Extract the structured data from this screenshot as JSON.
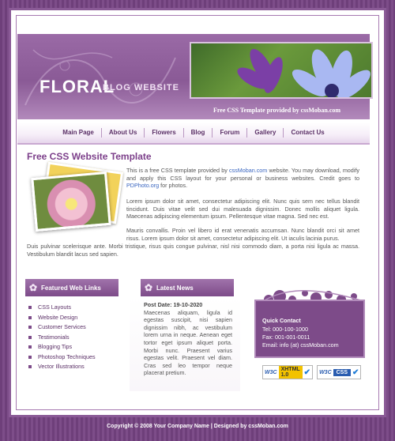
{
  "header": {
    "logo_title": "FLORAL",
    "logo_subtitle": "BLOG WEBSITE",
    "tagline": "Free CSS Template provided by cssMoban.com"
  },
  "nav": {
    "items": [
      "Main Page",
      "About Us",
      "Flowers",
      "Blog",
      "Forum",
      "Gallery",
      "Contact Us"
    ]
  },
  "content": {
    "title": "Free CSS Website Template",
    "intro_part1": "This is a free CSS template provided by ",
    "intro_link1": "cssMoban.com",
    "intro_part2": " website. You may download, modify and apply this CSS layout for your personal or business websites. Credit goes to ",
    "intro_link2": "PDPhoto.org",
    "intro_part3": " for photos.",
    "para2": "Lorem ipsum dolor sit amet, consectetur adipiscing elit. Nunc quis sem nec tellus blandit tincidunt. Duis vitae velit sed dui malesuada dignissim. Donec mollis aliquet ligula. Maecenas adipiscing elementum ipsum. Pellentesque vitae magna. Sed nec est.",
    "para3a": "Mauris convallis. Proin vel libero id erat venenatis accumsan. Nunc blandit orci sit amet risus. Lorem ipsum dolor sit amet, consectetur adipiscing elit. Ut iaculis lacinia purus.",
    "para3b": "Duis pulvinar scelerisque ante. Morbi tristique, risus quis congue pulvinar, nisl nisi commodo diam, a porta nisi ligula ac massa. Vestibulum blandit lacus sed sapien."
  },
  "featured_links": {
    "title": "Featured Web Links",
    "items": [
      "CSS Layouts",
      "Website Design",
      "Customer Services",
      "Testimonials",
      "Blogging Tips",
      "Photoshop Techniques",
      "Vector Illustrations"
    ]
  },
  "news": {
    "title": "Latest News",
    "date": "Post Date: 19-10-2020",
    "body": "Maecenas aliquam, ligula id egestas suscipit, nisi sapien dignissim nibh, ac vestibulum lorem urna in neque. Aenean eget tortor eget ipsum aliquet porta. Morbi nunc. Praesent varius egestas velit. Praesent vel diam. Cras sed leo tempor neque placerat pretium."
  },
  "contact": {
    "title": "Quick Contact",
    "tel": "Tel: 000-100-1000",
    "fax": "Fax: 001-001-0011",
    "email": "Email: info (at) cssMoban.com"
  },
  "badges": {
    "xhtml_w3c": "W3C",
    "xhtml_label": "XHTML",
    "xhtml_version": "1.0",
    "css_w3c": "W3C",
    "css_label": "CSS"
  },
  "footer": {
    "text": "Copyright © 2008 Your Company Name | Designed by cssMoban.com"
  },
  "colors": {
    "accent": "#7d4b89",
    "link": "#3a66c0",
    "background": "#6e3f7a"
  }
}
